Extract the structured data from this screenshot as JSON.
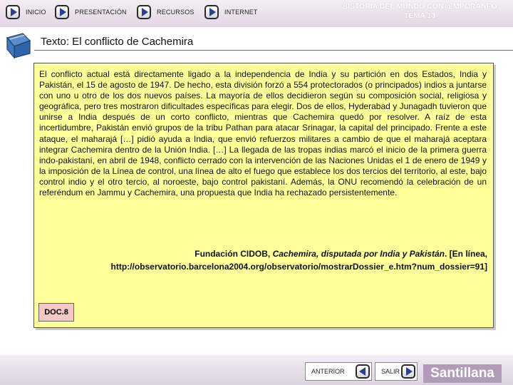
{
  "nav": {
    "items": [
      {
        "label": "INICIO"
      },
      {
        "label": "PRESENTACIÓN"
      },
      {
        "label": "RECURSOS"
      },
      {
        "label": "INTERNET"
      }
    ]
  },
  "header": {
    "line1": "HISTORIA DEL MUNDO CONTEMPORÁNEO",
    "line2": "TEMA 13"
  },
  "section": {
    "title": "Texto: El conflicto de Cachemira",
    "icon": "book-icon"
  },
  "document": {
    "body": "El conflicto actual está directamente ligado a la independencia de India y su partición en dos Estados, India y Pakistán, el 15 de agosto de 1947. De hecho, esta división forzó a 554 protectorados (o principados) indios a juntarse con uno u otro de los dos nuevos países. La mayoría de ellos decidieron según su composición social, religiosa y geográfica, pero tres mostraron dificultades específicas para elegir. Dos de ellos, Hyderabad y Junagadh tuvieron que unirse a India después de un corto conflicto, mientras que Cachemira quedó por resolver. A raíz de esta incertidumbre, Pakistán envió grupos de la tribu Pathan para atacar Srinagar, la capital del principado. Frente a este ataque, el maharajá […] pidió ayuda a India, que envió refuerzos militares a cambio de que el maharajá aceptara integrar Cachemira dentro de la Unión India. […] La llegada de las tropas indias marcó el inicio de la primera guerra indo-pakistaní, en abril de 1948, conflicto cerrado con la intervención de las Naciones Unidas el 1 de enero de 1949 y la imposición de la Línea de control, una línea de alto el fuego que establece los dos tercios del territorio, al este, bajo control indio y el otro tercio, al noroeste, bajo control pakistaní. Además, la ONU recomendó la celebración de un referéndum en Jammu y Cachemira, una propuesta que India ha rechazado persistentemente.",
    "source_prefix": "Fundación CIDOB, ",
    "source_title": "Cachemira, disputada por India y Pakistán",
    "source_suffix": ". [En línea,",
    "source_url": "http://observatorio.barcelona2004.org/observatorio/mostrarDossier_e.htm?num_dossier=91]",
    "badge": "DOC.8"
  },
  "footer": {
    "prev_label": "ANTERIOR",
    "exit_label": "SALIR",
    "brand": "Santillana"
  },
  "colors": {
    "doc_background": "#ffff99",
    "badge_background": "#f5c8c8",
    "brand_background": "#b19bb9",
    "arrow_color": "#2c3e8c"
  }
}
